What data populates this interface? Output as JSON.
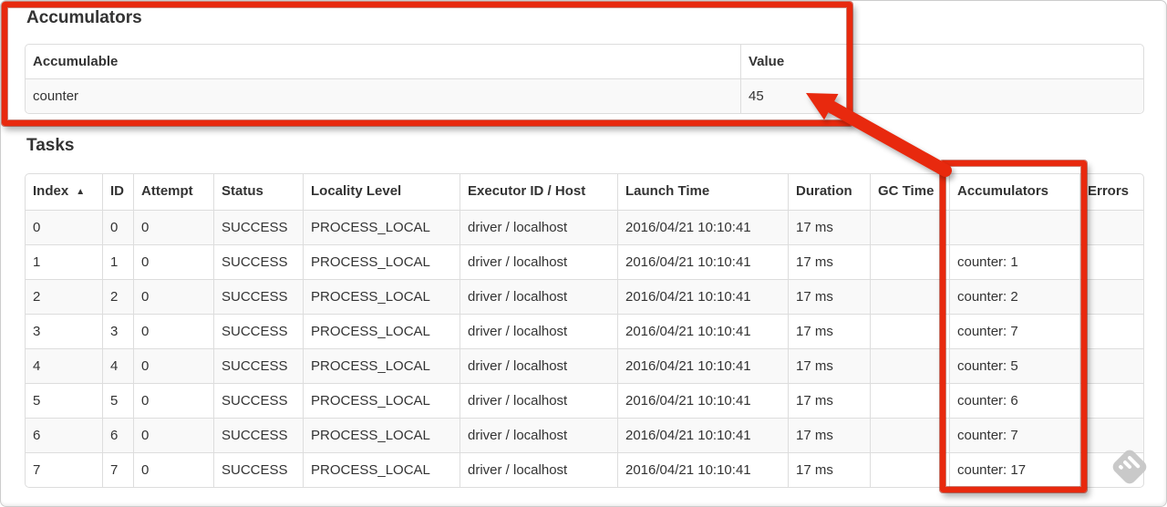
{
  "accumulators_section": {
    "heading": "Accumulators",
    "table": {
      "headers": {
        "accumulable": "Accumulable",
        "value": "Value"
      },
      "rows": [
        {
          "accumulable": "counter",
          "value": "45"
        }
      ]
    }
  },
  "tasks_section": {
    "heading": "Tasks",
    "table": {
      "headers": {
        "index": "Index",
        "id": "ID",
        "attempt": "Attempt",
        "status": "Status",
        "locality": "Locality Level",
        "executor": "Executor ID / Host",
        "launch": "Launch Time",
        "duration": "Duration",
        "gc": "GC Time",
        "accumulators": "Accumulators",
        "errors": "Errors"
      },
      "sort_icon": "▲",
      "rows": [
        {
          "index": "0",
          "id": "0",
          "attempt": "0",
          "status": "SUCCESS",
          "locality": "PROCESS_LOCAL",
          "executor": "driver / localhost",
          "launch": "2016/04/21 10:10:41",
          "duration": "17 ms",
          "gc": "",
          "accumulators": "",
          "errors": ""
        },
        {
          "index": "1",
          "id": "1",
          "attempt": "0",
          "status": "SUCCESS",
          "locality": "PROCESS_LOCAL",
          "executor": "driver / localhost",
          "launch": "2016/04/21 10:10:41",
          "duration": "17 ms",
          "gc": "",
          "accumulators": "counter: 1",
          "errors": ""
        },
        {
          "index": "2",
          "id": "2",
          "attempt": "0",
          "status": "SUCCESS",
          "locality": "PROCESS_LOCAL",
          "executor": "driver / localhost",
          "launch": "2016/04/21 10:10:41",
          "duration": "17 ms",
          "gc": "",
          "accumulators": "counter: 2",
          "errors": ""
        },
        {
          "index": "3",
          "id": "3",
          "attempt": "0",
          "status": "SUCCESS",
          "locality": "PROCESS_LOCAL",
          "executor": "driver / localhost",
          "launch": "2016/04/21 10:10:41",
          "duration": "17 ms",
          "gc": "",
          "accumulators": "counter: 7",
          "errors": ""
        },
        {
          "index": "4",
          "id": "4",
          "attempt": "0",
          "status": "SUCCESS",
          "locality": "PROCESS_LOCAL",
          "executor": "driver / localhost",
          "launch": "2016/04/21 10:10:41",
          "duration": "17 ms",
          "gc": "",
          "accumulators": "counter: 5",
          "errors": ""
        },
        {
          "index": "5",
          "id": "5",
          "attempt": "0",
          "status": "SUCCESS",
          "locality": "PROCESS_LOCAL",
          "executor": "driver / localhost",
          "launch": "2016/04/21 10:10:41",
          "duration": "17 ms",
          "gc": "",
          "accumulators": "counter: 6",
          "errors": ""
        },
        {
          "index": "6",
          "id": "6",
          "attempt": "0",
          "status": "SUCCESS",
          "locality": "PROCESS_LOCAL",
          "executor": "driver / localhost",
          "launch": "2016/04/21 10:10:41",
          "duration": "17 ms",
          "gc": "",
          "accumulators": "counter: 7",
          "errors": ""
        },
        {
          "index": "7",
          "id": "7",
          "attempt": "0",
          "status": "SUCCESS",
          "locality": "PROCESS_LOCAL",
          "executor": "driver / localhost",
          "launch": "2016/04/21 10:10:41",
          "duration": "17 ms",
          "gc": "",
          "accumulators": "counter: 17",
          "errors": ""
        }
      ]
    }
  },
  "annotations": {
    "accent_color": "#e8290e",
    "boxes": [
      "accumulators-section",
      "accumulators-column"
    ],
    "arrow_target": "45"
  },
  "watermark_icon": "skitch-watermark-icon"
}
